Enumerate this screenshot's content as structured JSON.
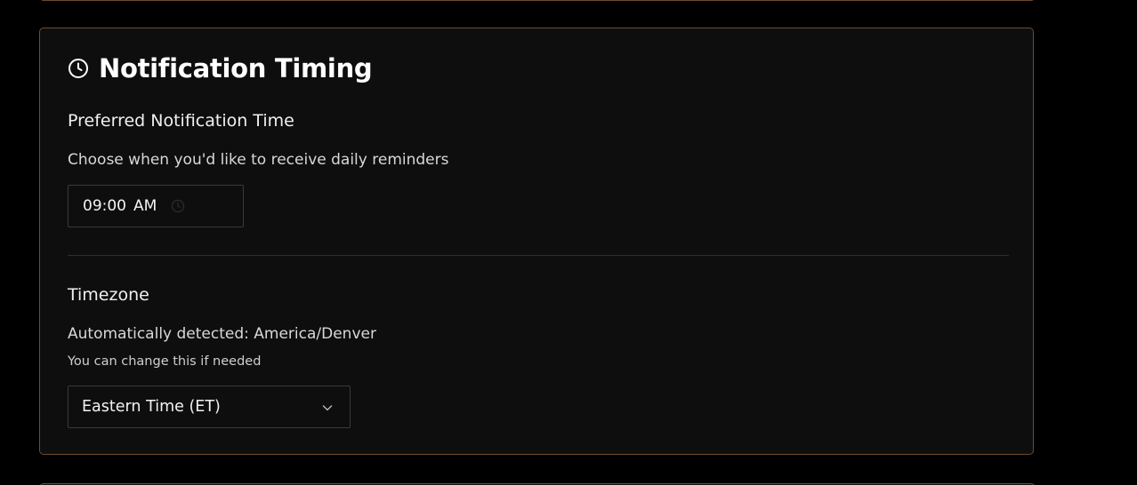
{
  "card": {
    "title": "Notification Timing",
    "title_icon": "clock-icon"
  },
  "notification_time": {
    "label": "Preferred Notification Time",
    "description": "Choose when you'd like to receive daily reminders",
    "time_value": "09:00",
    "time_period": "AM",
    "input_icon": "clock-icon"
  },
  "timezone": {
    "label": "Timezone",
    "detected_text": "Automatically detected: America/Denver",
    "hint": "You can change this if needed",
    "selected": "Eastern Time (ET)",
    "select_icon": "chevron-down-icon"
  },
  "colors": {
    "background": "#000000",
    "card_background": "#0e0e0e",
    "card_border": "#6e4a30",
    "text_primary": "#ffffff",
    "divider": "#2e2e2e"
  }
}
